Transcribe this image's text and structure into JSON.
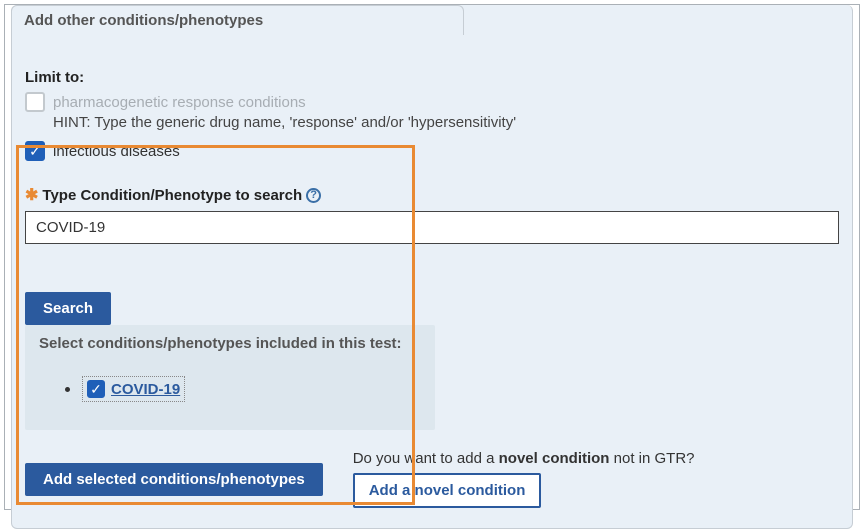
{
  "tab_label": "Add other conditions/phenotypes",
  "limit_to_label": "Limit to:",
  "limit_options": {
    "pharmacogenetic": {
      "label": "pharmacogenetic response conditions",
      "hint": "HINT: Type the generic drug name, 'response' and/or 'hypersensitivity'"
    },
    "infectious": {
      "label": "infectious diseases"
    }
  },
  "search": {
    "label": "Type Condition/Phenotype to search",
    "value": "COVID-19",
    "button": "Search"
  },
  "results": {
    "heading": "Select conditions/phenotypes included in this test:",
    "items": [
      {
        "label": "COVID-19"
      }
    ]
  },
  "add_selected_button": "Add selected conditions/phenotypes",
  "novel": {
    "prompt_prefix": "Do you want to add a ",
    "prompt_bold": "novel condition",
    "prompt_suffix": " not in GTR?",
    "button": "Add a novel condition"
  }
}
